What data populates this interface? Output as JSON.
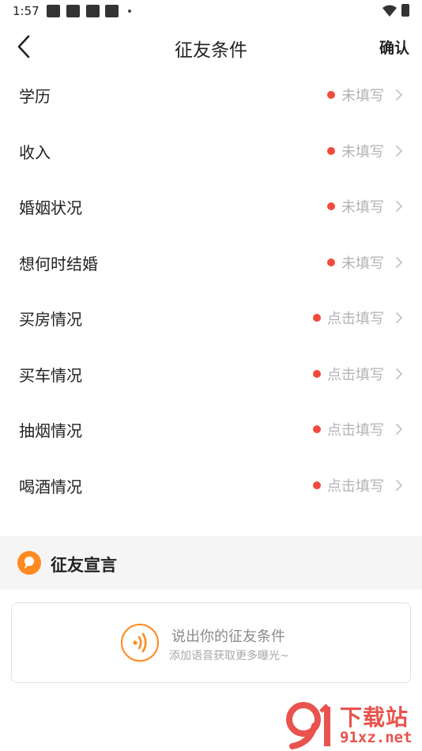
{
  "status_bar": {
    "time": "1:57"
  },
  "header": {
    "title": "征友条件",
    "confirm_label": "确认"
  },
  "rows": [
    {
      "label": "学历",
      "status": "未填写"
    },
    {
      "label": "收入",
      "status": "未填写"
    },
    {
      "label": "婚姻状况",
      "status": "未填写"
    },
    {
      "label": "想何时结婚",
      "status": "未填写"
    },
    {
      "label": "买房情况",
      "status": "点击填写"
    },
    {
      "label": "买车情况",
      "status": "点击填写"
    },
    {
      "label": "抽烟情况",
      "status": "点击填写"
    },
    {
      "label": "喝酒情况",
      "status": "点击填写"
    }
  ],
  "section": {
    "title": "征友宣言"
  },
  "voice_card": {
    "title": "说出你的征友条件",
    "subtitle": "添加语音获取更多曝光~"
  },
  "watermark": {
    "title": "下载站",
    "url": "91xz.net"
  },
  "colors": {
    "accent": "#ff8a1f",
    "dot": "#f24b3d",
    "watermark": "#e8534d"
  }
}
